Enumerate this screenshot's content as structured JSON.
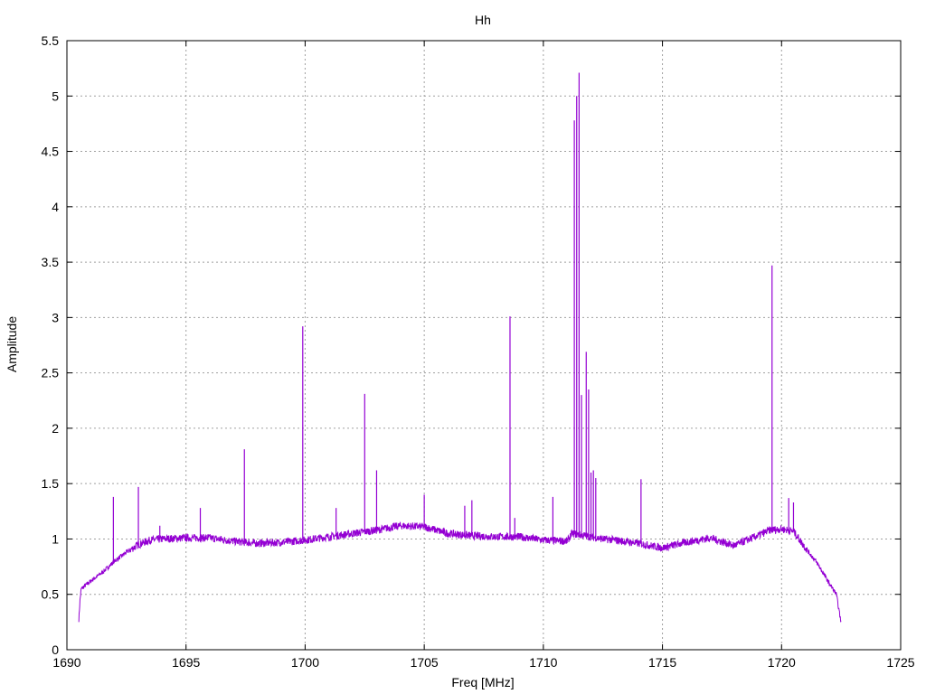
{
  "chart_data": {
    "type": "line",
    "title": "Hh",
    "xlabel": "Freq [MHz]",
    "ylabel": "Amplitude",
    "xlim": [
      1690,
      1725
    ],
    "ylim": [
      0,
      5.5
    ],
    "xticks": [
      1690,
      1695,
      1700,
      1705,
      1710,
      1715,
      1720,
      1725
    ],
    "yticks": [
      0,
      0.5,
      1,
      1.5,
      2,
      2.5,
      3,
      3.5,
      4,
      4.5,
      5,
      5.5
    ],
    "ytick_labels": [
      "0",
      "0.5",
      "1",
      "1.5",
      "2",
      "2.5",
      "3",
      "3.5",
      "4",
      "4.5",
      "5",
      "5.5"
    ],
    "grid": true,
    "series": [
      {
        "color": "#9400d3",
        "baseline": [
          [
            1690.5,
            0.27
          ],
          [
            1690.55,
            0.45
          ],
          [
            1690.6,
            0.55
          ],
          [
            1691.0,
            0.62
          ],
          [
            1691.5,
            0.7
          ],
          [
            1692.0,
            0.8
          ],
          [
            1692.5,
            0.88
          ],
          [
            1693.0,
            0.95
          ],
          [
            1693.5,
            0.99
          ],
          [
            1694.0,
            1.0
          ],
          [
            1695.0,
            1.01
          ],
          [
            1696.0,
            1.01
          ],
          [
            1697.0,
            0.98
          ],
          [
            1698.0,
            0.96
          ],
          [
            1699.0,
            0.97
          ],
          [
            1700.0,
            0.99
          ],
          [
            1701.0,
            1.02
          ],
          [
            1702.0,
            1.05
          ],
          [
            1703.0,
            1.08
          ],
          [
            1704.0,
            1.12
          ],
          [
            1705.0,
            1.11
          ],
          [
            1706.0,
            1.05
          ],
          [
            1707.0,
            1.03
          ],
          [
            1708.0,
            1.02
          ],
          [
            1709.0,
            1.02
          ],
          [
            1710.0,
            0.99
          ],
          [
            1711.0,
            0.98
          ],
          [
            1711.2,
            1.05
          ],
          [
            1712.5,
            1.0
          ],
          [
            1713.0,
            0.99
          ],
          [
            1714.0,
            0.96
          ],
          [
            1715.0,
            0.92
          ],
          [
            1716.0,
            0.97
          ],
          [
            1717.0,
            1.01
          ],
          [
            1718.0,
            0.94
          ],
          [
            1719.0,
            1.03
          ],
          [
            1719.5,
            1.08
          ],
          [
            1720.0,
            1.09
          ],
          [
            1720.5,
            1.07
          ],
          [
            1721.0,
            0.92
          ],
          [
            1721.5,
            0.78
          ],
          [
            1722.0,
            0.6
          ],
          [
            1722.3,
            0.5
          ],
          [
            1722.5,
            0.24
          ]
        ],
        "spikes": [
          [
            1691.95,
            1.38
          ],
          [
            1693.0,
            1.47
          ],
          [
            1693.9,
            1.12
          ],
          [
            1695.6,
            1.28
          ],
          [
            1697.45,
            1.81
          ],
          [
            1699.9,
            2.92
          ],
          [
            1701.3,
            1.28
          ],
          [
            1702.5,
            2.31
          ],
          [
            1703.0,
            1.62
          ],
          [
            1705.0,
            1.4
          ],
          [
            1706.7,
            1.3
          ],
          [
            1707.0,
            1.35
          ],
          [
            1708.6,
            3.01
          ],
          [
            1708.8,
            1.19
          ],
          [
            1710.4,
            1.38
          ],
          [
            1711.3,
            4.78
          ],
          [
            1711.4,
            5.0
          ],
          [
            1711.5,
            5.21
          ],
          [
            1711.6,
            2.3
          ],
          [
            1711.8,
            2.69
          ],
          [
            1711.9,
            2.35
          ],
          [
            1712.0,
            1.6
          ],
          [
            1712.1,
            1.62
          ],
          [
            1712.2,
            1.55
          ],
          [
            1714.1,
            1.54
          ],
          [
            1719.6,
            3.47
          ],
          [
            1720.3,
            1.37
          ],
          [
            1720.5,
            1.33
          ]
        ]
      }
    ]
  }
}
